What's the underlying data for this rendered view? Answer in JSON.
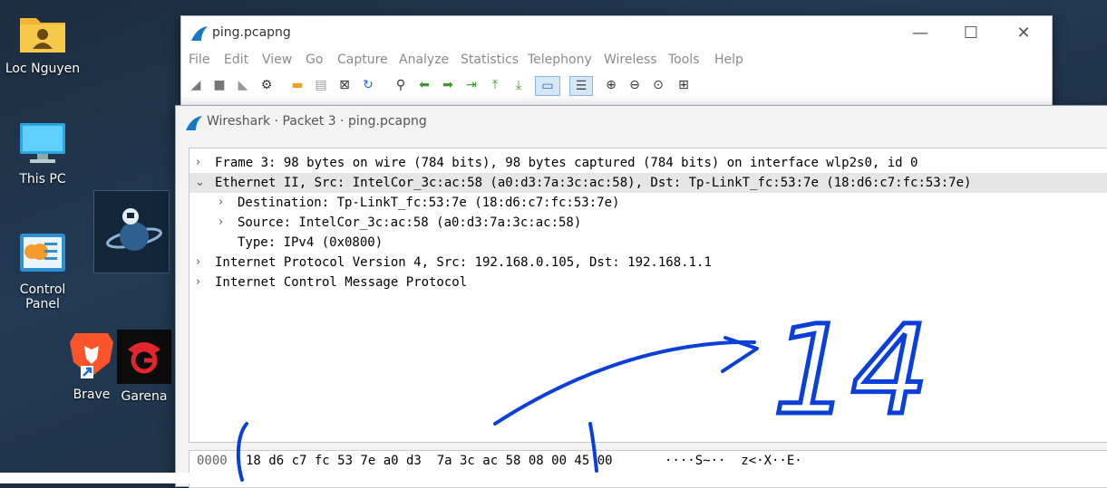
{
  "desktop": {
    "icons": [
      {
        "label": "Loc Nguyen",
        "icon": "user-folder-icon"
      },
      {
        "label": "This PC",
        "icon": "monitor-icon"
      },
      {
        "label": "Control Panel",
        "icon": "control-panel-icon"
      },
      {
        "label": "Brave",
        "icon": "brave-icon"
      },
      {
        "label": "Garena",
        "icon": "garena-icon"
      }
    ]
  },
  "main_window": {
    "title": "ping.pcapng",
    "menu": [
      "File",
      "Edit",
      "View",
      "Go",
      "Capture",
      "Analyze",
      "Statistics",
      "Telephony",
      "Wireless",
      "Tools",
      "Help"
    ],
    "controls": {
      "minimize": "—",
      "maximize": "☐",
      "close": "✕"
    }
  },
  "packet_window": {
    "title": "Wireshark · Packet 3 · ping.pcapng",
    "tree": [
      {
        "text": "Frame 3: 98 bytes on wire (784 bits), 98 bytes captured (784 bits) on interface wlp2s0, id 0",
        "expanded": false,
        "indent": 0
      },
      {
        "text": "Ethernet II, Src: IntelCor_3c:ac:58 (a0:d3:7a:3c:ac:58), Dst: Tp-LinkT_fc:53:7e (18:d6:c7:fc:53:7e)",
        "expanded": true,
        "indent": 0,
        "selected": true
      },
      {
        "text": "Destination: Tp-LinkT_fc:53:7e (18:d6:c7:fc:53:7e)",
        "expanded": false,
        "indent": 1
      },
      {
        "text": "Source: IntelCor_3c:ac:58 (a0:d3:7a:3c:ac:58)",
        "expanded": false,
        "indent": 1
      },
      {
        "text": "Type: IPv4 (0x0800)",
        "expanded": null,
        "indent": 1
      },
      {
        "text": "Internet Protocol Version 4, Src: 192.168.0.105, Dst: 192.168.1.1",
        "expanded": false,
        "indent": 0
      },
      {
        "text": "Internet Control Message Protocol",
        "expanded": false,
        "indent": 0
      }
    ],
    "hex": {
      "offset": "0000",
      "bytes": "18 d6 c7 fc 53 7e a0 d3  7a 3c ac 58 08 00 45 00",
      "ascii": "····S~··  z<·X··E·"
    }
  },
  "annotation": {
    "text": "14",
    "color": "#0b3fd9"
  }
}
